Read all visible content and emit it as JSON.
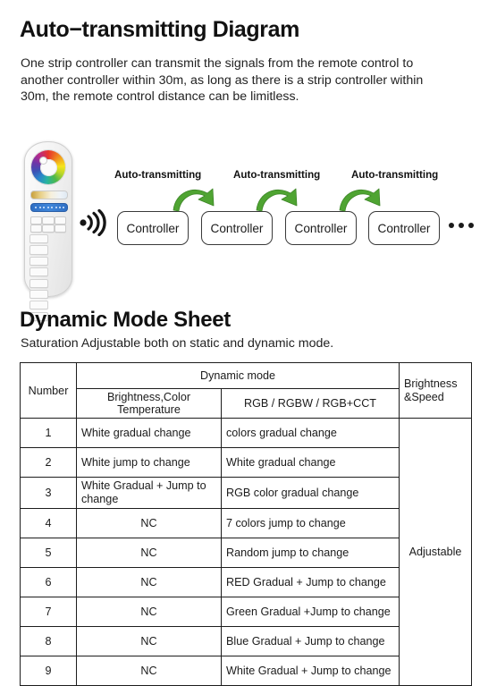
{
  "section1": {
    "heading": "Auto−transmitting Diagram",
    "paragraph": "One strip controller can transmit the signals from the remote control to another controller within 30m, as long as there is a strip controller within 30m, the remote control distance can be limitless."
  },
  "diagram": {
    "transmit_labels": [
      "Auto-transmitting",
      "Auto-transmitting",
      "Auto-transmitting"
    ],
    "controllers": [
      "Controller",
      "Controller",
      "Controller",
      "Controller"
    ],
    "ellipsis": "•••",
    "arrow_color": "#4FA432",
    "remote": {
      "name": "rgb-remote-control",
      "wheel": "color-wheel",
      "cct_slider": "color-temperature-slider",
      "brightness_slider": "brightness-slider"
    }
  },
  "section2": {
    "heading": "Dynamic Mode Sheet",
    "subtitle": "Saturation Adjustable both on static and dynamic mode."
  },
  "table": {
    "header": {
      "number": "Number",
      "dynamic_mode": "Dynamic mode",
      "col_bct": "Brightness,Color Temperature",
      "col_rgb": "RGB / RGBW / RGB+CCT",
      "brightness_speed": "Brightness\n&Speed",
      "brightness_speed_line1": "Brightness",
      "brightness_speed_line2": "&Speed"
    },
    "brightness_speed_value": "Adjustable",
    "rows": [
      {
        "number": "1",
        "bct": "White gradual change",
        "rgb": "colors gradual change"
      },
      {
        "number": "2",
        "bct": "White jump to change",
        "rgb": "White gradual change"
      },
      {
        "number": "3",
        "bct": "White Gradual + Jump to change",
        "rgb": "RGB color gradual change"
      },
      {
        "number": "4",
        "bct": "NC",
        "rgb": "7 colors jump to change"
      },
      {
        "number": "5",
        "bct": "NC",
        "rgb": "Random jump to change"
      },
      {
        "number": "6",
        "bct": "NC",
        "rgb": "RED Gradual + Jump to change"
      },
      {
        "number": "7",
        "bct": "NC",
        "rgb": "Green Gradual +Jump to change"
      },
      {
        "number": "8",
        "bct": "NC",
        "rgb": "Blue Gradual + Jump to change"
      },
      {
        "number": "9",
        "bct": "NC",
        "rgb": "White Gradual + Jump to change"
      }
    ]
  }
}
